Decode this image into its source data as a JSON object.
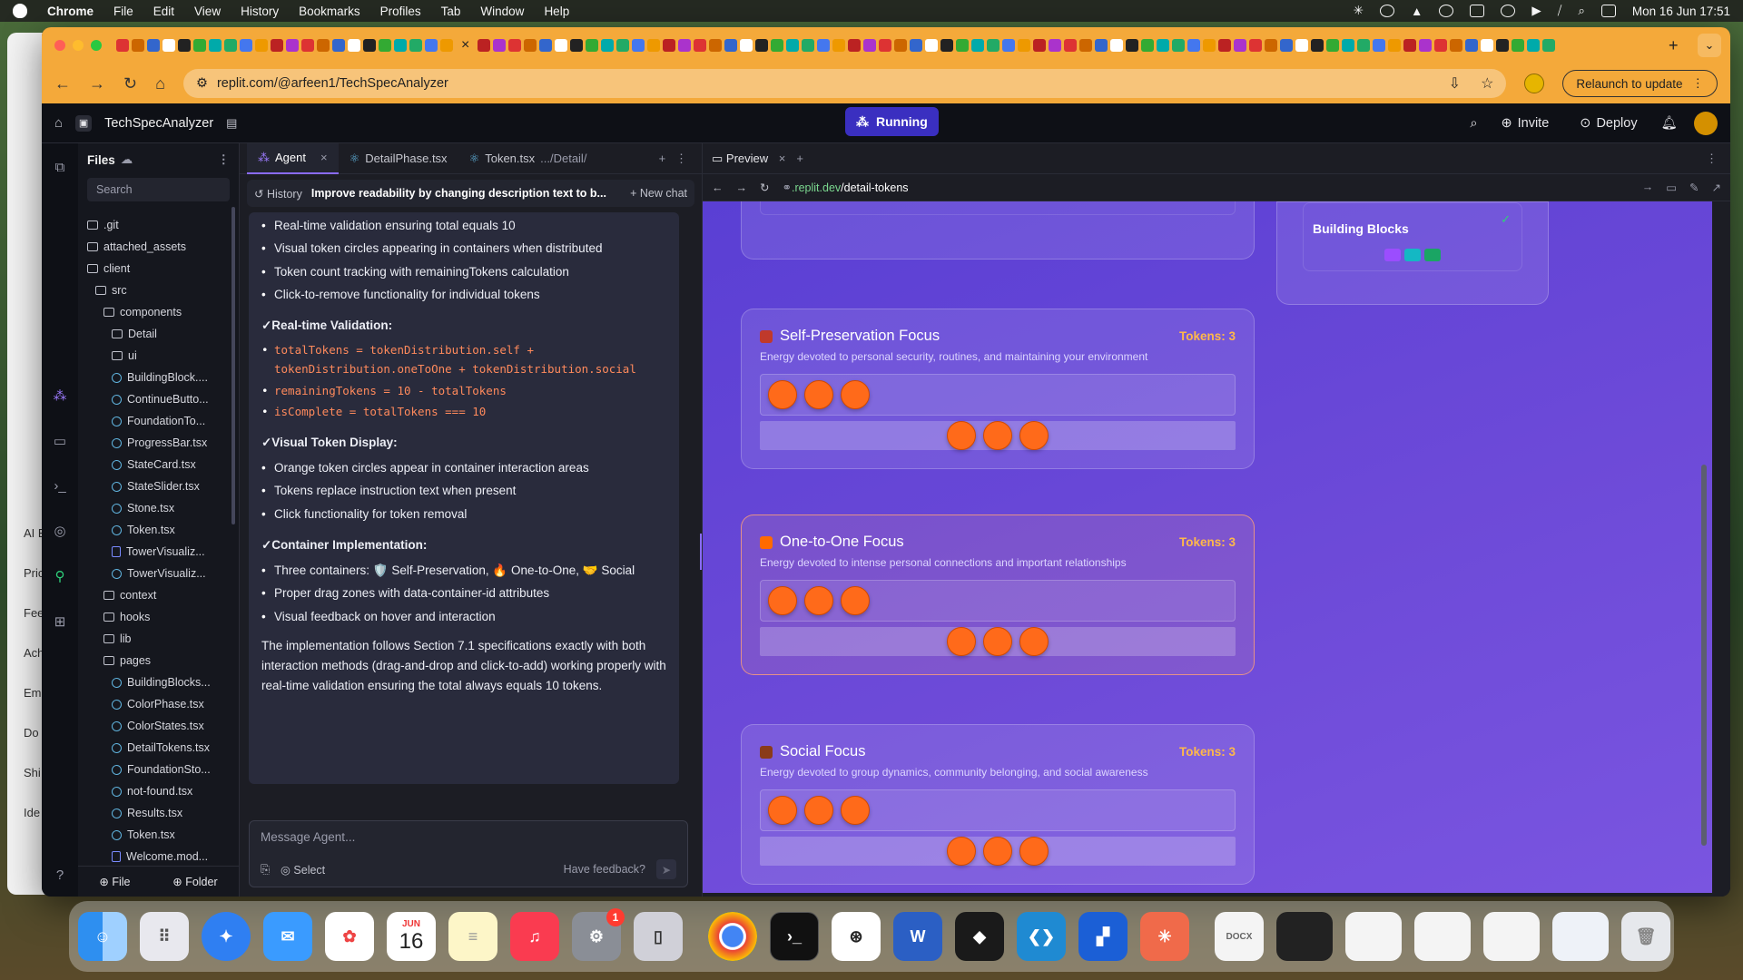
{
  "menubar": {
    "app": "Chrome",
    "items": [
      "File",
      "Edit",
      "View",
      "History",
      "Bookmarks",
      "Profiles",
      "Tab",
      "Window",
      "Help"
    ],
    "datetime": "Mon 16 Jun  17:51"
  },
  "bgwindow": {
    "labels": [
      "AI E",
      "Pric",
      "Fee",
      "Ach",
      "Em",
      "Do",
      "Shi",
      "Ide"
    ]
  },
  "browser": {
    "url": "replit.com/@arfeen1/TechSpecAnalyzer",
    "relaunch_label": "Relaunch to update",
    "accent": "#f4a93a"
  },
  "replit": {
    "project": "TechSpecAnalyzer",
    "status": "Running",
    "invite": "Invite",
    "deploy": "Deploy"
  },
  "files": {
    "title": "Files",
    "search_placeholder": "Search",
    "items": [
      {
        "name": ".git",
        "type": "folder",
        "depth": 0
      },
      {
        "name": "attached_assets",
        "type": "folder",
        "depth": 0
      },
      {
        "name": "client",
        "type": "folder-open",
        "depth": 0
      },
      {
        "name": "src",
        "type": "folder-open",
        "depth": 1
      },
      {
        "name": "components",
        "type": "folder-open",
        "depth": 2
      },
      {
        "name": "Detail",
        "type": "folder",
        "depth": 3
      },
      {
        "name": "ui",
        "type": "folder",
        "depth": 3
      },
      {
        "name": "BuildingBlock....",
        "type": "react",
        "depth": 3
      },
      {
        "name": "ContinueButto...",
        "type": "react",
        "depth": 3
      },
      {
        "name": "FoundationTo...",
        "type": "react",
        "depth": 3
      },
      {
        "name": "ProgressBar.tsx",
        "type": "react",
        "depth": 3
      },
      {
        "name": "StateCard.tsx",
        "type": "react",
        "depth": 3
      },
      {
        "name": "StateSlider.tsx",
        "type": "react",
        "depth": 3
      },
      {
        "name": "Stone.tsx",
        "type": "react",
        "depth": 3
      },
      {
        "name": "Token.tsx",
        "type": "react",
        "depth": 3
      },
      {
        "name": "TowerVisualiz...",
        "type": "file",
        "depth": 3
      },
      {
        "name": "TowerVisualiz...",
        "type": "react",
        "depth": 3
      },
      {
        "name": "context",
        "type": "folder",
        "depth": 2
      },
      {
        "name": "hooks",
        "type": "folder",
        "depth": 2
      },
      {
        "name": "lib",
        "type": "folder",
        "depth": 2
      },
      {
        "name": "pages",
        "type": "folder-open",
        "depth": 2
      },
      {
        "name": "BuildingBlocks...",
        "type": "react",
        "depth": 3
      },
      {
        "name": "ColorPhase.tsx",
        "type": "react",
        "depth": 3
      },
      {
        "name": "ColorStates.tsx",
        "type": "react",
        "depth": 3
      },
      {
        "name": "DetailTokens.tsx",
        "type": "react",
        "depth": 3
      },
      {
        "name": "FoundationSto...",
        "type": "react",
        "depth": 3
      },
      {
        "name": "not-found.tsx",
        "type": "react",
        "depth": 3
      },
      {
        "name": "Results.tsx",
        "type": "react",
        "depth": 3
      },
      {
        "name": "Token.tsx",
        "type": "react",
        "depth": 3
      },
      {
        "name": "Welcome.mod...",
        "type": "file",
        "depth": 3
      }
    ],
    "foot_file": "File",
    "foot_folder": "Folder"
  },
  "editor_tabs": {
    "agent": "Agent",
    "detail_phase": "DetailPhase.tsx",
    "token": "Token.tsx",
    "token_path": ".../Detail/"
  },
  "chat": {
    "history": "History",
    "topic": "Improve readability by changing description text to b...",
    "new_chat": "New chat",
    "list1": [
      "Real-time validation ensuring total equals 10",
      "Visual token circles appearing in containers when distributed",
      "Token count tracking with remainingTokens calculation",
      "Click-to-remove functionality for individual tokens"
    ],
    "h_validation": "✓Real-time Validation:",
    "code": [
      "totalTokens = tokenDistribution.self + tokenDistribution.oneToOne + tokenDistribution.social",
      "remainingTokens = 10 - totalTokens",
      "isComplete = totalTokens === 10"
    ],
    "h_visual": "✓Visual Token Display:",
    "list2": [
      "Orange token circles appear in container interaction areas",
      "Tokens replace instruction text when present",
      "Click functionality for token removal"
    ],
    "h_container": "✓Container Implementation:",
    "list3": [
      "Three containers: 🛡️ Self-Preservation, 🔥 One-to-One, 🤝 Social",
      "Proper drag zones with data-container-id attributes",
      "Visual feedback on hover and interaction"
    ],
    "summary": "The implementation follows Section 7.1 specifications exactly with both interaction methods (drag-and-drop and click-to-add) working properly with real-time validation ensuring the total always equals 10 tokens.",
    "composer_placeholder": "Message Agent...",
    "select": "Select",
    "feedback": "Have feedback?"
  },
  "preview": {
    "tab": "Preview",
    "url_domain": ".replit.dev",
    "url_path": "/detail-tokens",
    "building_blocks": "Building Blocks",
    "block_colors": [
      "#9b4dff",
      "#14b8c4",
      "#1aa564"
    ],
    "cards": [
      {
        "title": "Self-Preservation Focus",
        "tokens": "Tokens: 3",
        "desc": "Energy devoted to personal security, routines, and maintaining your environment",
        "placed": 3,
        "bar": 3,
        "icon_color": "#c0392b"
      },
      {
        "title": "One-to-One Focus",
        "tokens": "Tokens: 3",
        "desc": "Energy devoted to intense personal connections and important relationships",
        "placed": 3,
        "bar": 3,
        "icon_color": "#ff6a00"
      },
      {
        "title": "Social Focus",
        "tokens": "Tokens: 3",
        "desc": "Energy devoted to group dynamics, community belonging, and social awareness",
        "placed": 3,
        "bar": 3,
        "icon_color": "#8a3b1a"
      }
    ]
  },
  "dock": {
    "calendar_month": "JUN",
    "calendar_day": "16",
    "settings_badge": "1",
    "apps": [
      "finder",
      "launchpad",
      "safari",
      "mail",
      "photos",
      "calendar",
      "notes",
      "music",
      "settings",
      "iphone-mirroring",
      "chrome",
      "terminal",
      "chatgpt",
      "word",
      "cursor",
      "vscode",
      "teams",
      "claude"
    ]
  }
}
